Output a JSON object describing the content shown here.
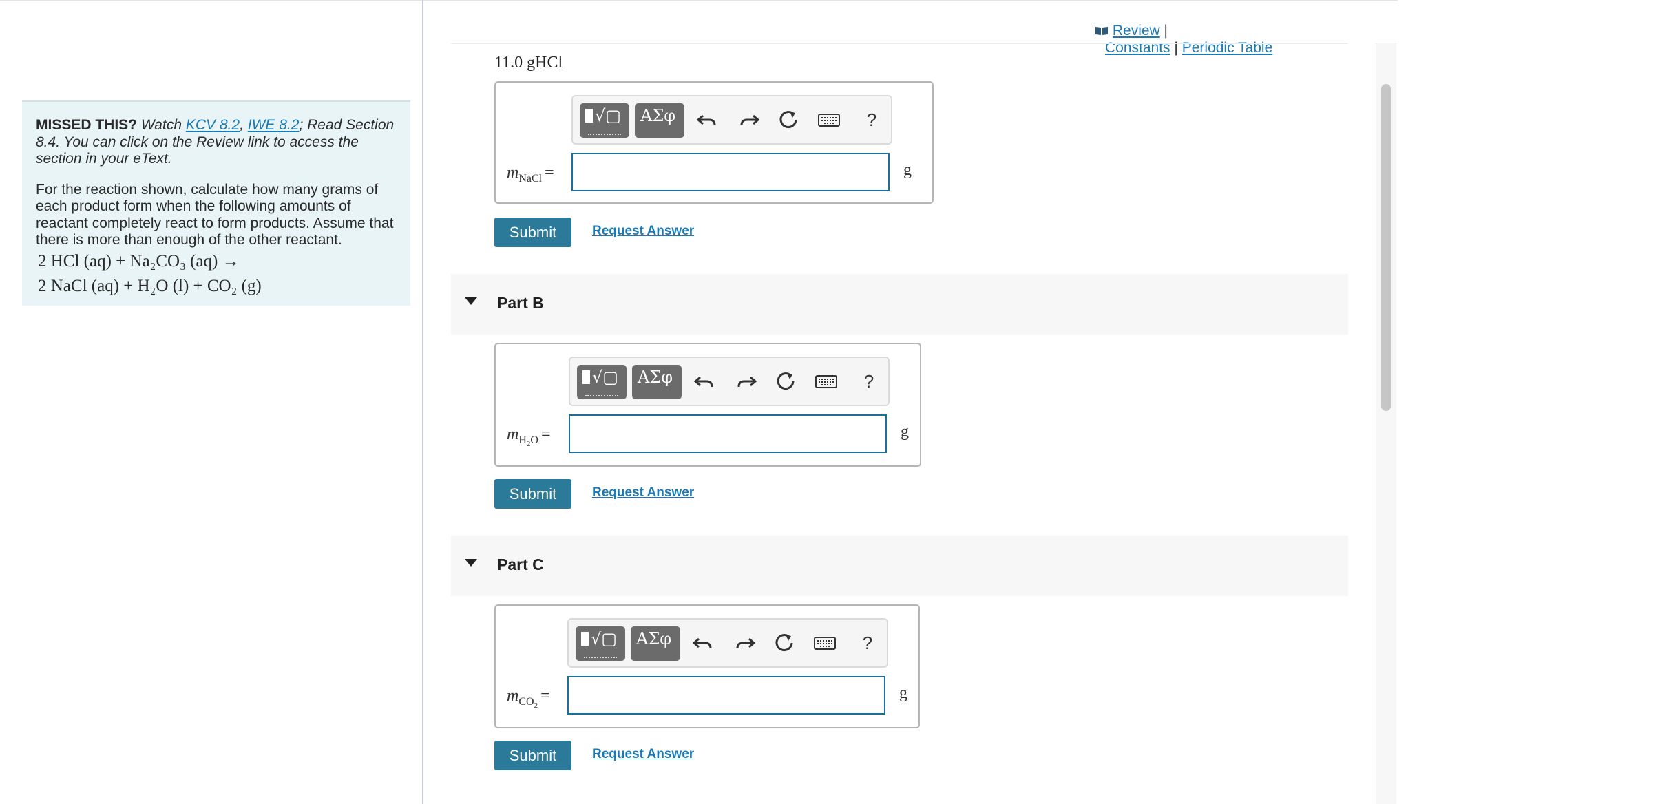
{
  "sidebar": {
    "missed_title": "MISSED THIS?",
    "watch_text": "Watch",
    "kcv_link": "KCV 8.2",
    "comma": ",",
    "iwe_link": "IWE 8.2",
    "read_text": "; Read Section 8.4. You can click on the Review link to access the section in your eText.",
    "instructions": "For the reaction shown, calculate how many grams of each product form when the following amounts of reactant completely react to form products. Assume that there is more than enough of the other reactant.",
    "equation_line1": "2 HCl (aq) + Na₂CO₃ (aq) →",
    "equation_line2": "2 NaCl (aq) + H₂O (l) + CO₂ (g)"
  },
  "header": {
    "review_label": "Review",
    "sep1": "|",
    "constants_label": "Constants",
    "sep2": "|",
    "periodic_table_label": "Periodic Table"
  },
  "given_quantity": "11.0 gHCl",
  "toolbar": {
    "template_glyph": "√▢",
    "greek_glyph": "ΑΣφ",
    "help_label": "?"
  },
  "parts": [
    {
      "var_main": "m",
      "var_sub": "NaCl",
      "var_subsub": "",
      "var_sub_tail": "",
      "equals": "=",
      "value": "",
      "unit": "g",
      "submit_label": "Submit",
      "request_label": "Request Answer"
    },
    {
      "header": "Part B",
      "var_main": "m",
      "var_sub": "H",
      "var_subsub": "2",
      "var_sub_tail": "O",
      "equals": "=",
      "value": "",
      "unit": "g",
      "submit_label": "Submit",
      "request_label": "Request Answer"
    },
    {
      "header": "Part C",
      "var_main": "m",
      "var_sub": "CO",
      "var_subsub": "2",
      "var_sub_tail": "",
      "equals": "=",
      "value": "",
      "unit": "g",
      "submit_label": "Submit",
      "request_label": "Request Answer"
    }
  ],
  "colors": {
    "accent": "#2b7a99",
    "link": "#1b7ab3",
    "input_border": "#1b6f9e",
    "sidebar_bg": "#e9f4f6"
  }
}
